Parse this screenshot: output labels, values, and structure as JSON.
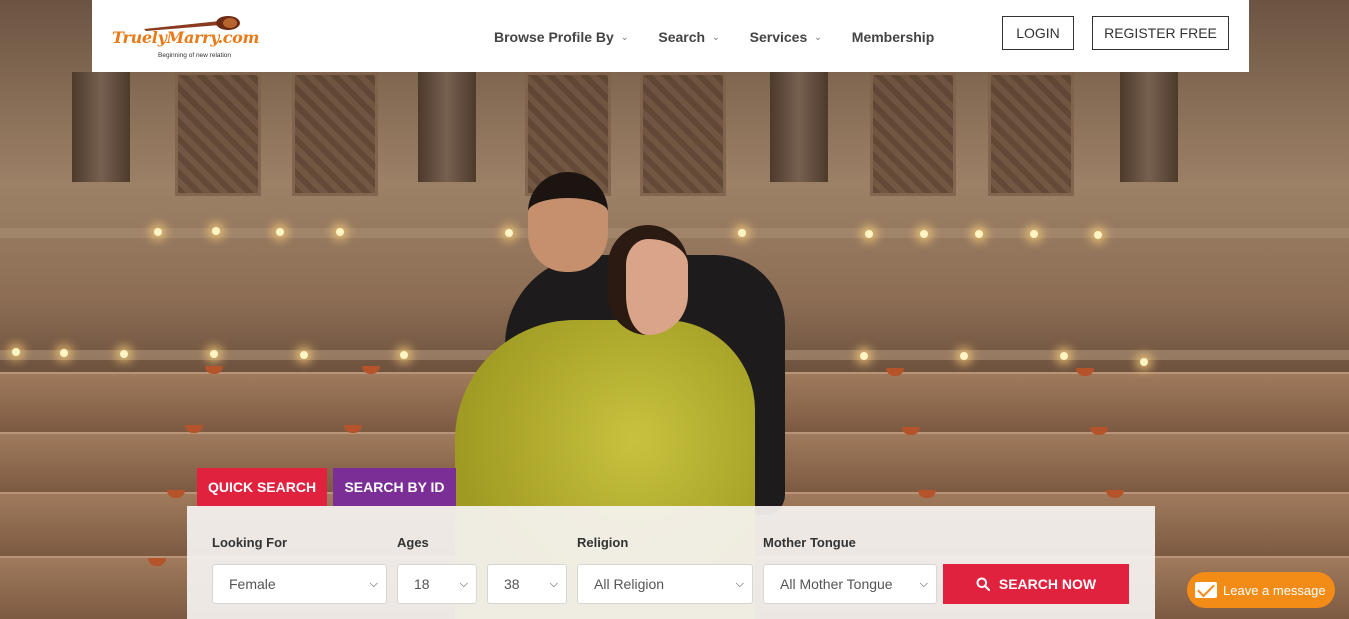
{
  "brand": {
    "name": "TruelyMarry.com",
    "tagline": "Beginning of new relation"
  },
  "nav": {
    "items": [
      {
        "label": "Browse Profile By",
        "has_dropdown": true
      },
      {
        "label": "Search",
        "has_dropdown": true
      },
      {
        "label": "Services",
        "has_dropdown": true
      },
      {
        "label": "Membership",
        "has_dropdown": false
      }
    ],
    "login_label": "LOGIN",
    "register_label": "REGISTER FREE"
  },
  "search": {
    "tabs": [
      {
        "label": "QUICK SEARCH",
        "active": true,
        "color": "#e0223f"
      },
      {
        "label": "SEARCH BY ID",
        "active": false,
        "color": "#7a2e96"
      }
    ],
    "looking_for": {
      "label": "Looking For",
      "value": "Female"
    },
    "ages": {
      "label": "Ages",
      "from": "18",
      "to": "38"
    },
    "religion": {
      "label": "Religion",
      "value": "All Religion"
    },
    "mother_tongue": {
      "label": "Mother Tongue",
      "value": "All Mother Tongue"
    },
    "submit_label": "SEARCH NOW"
  },
  "chat": {
    "label": "Leave a message",
    "icon": "envelope-icon"
  },
  "colors": {
    "accent_red": "#e0223f",
    "accent_purple": "#7a2e96",
    "brand_orange": "#f28c17"
  }
}
